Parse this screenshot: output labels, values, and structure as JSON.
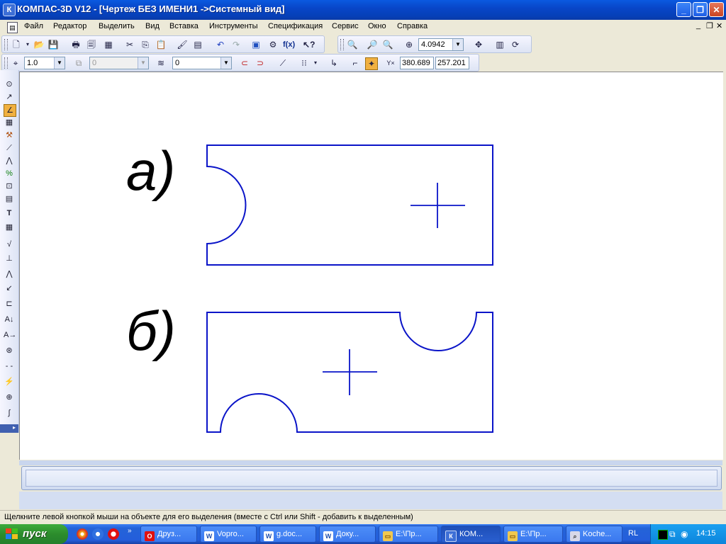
{
  "window": {
    "title": "КОМПАС-3D V12 - [Чертеж БЕЗ ИМЕНИ1 ->Системный вид]",
    "app_icon": "К"
  },
  "menu": {
    "items": [
      "Файл",
      "Редактор",
      "Выделить",
      "Вид",
      "Вставка",
      "Инструменты",
      "Спецификация",
      "Сервис",
      "Окно",
      "Справка"
    ]
  },
  "toolbar": {
    "zoom_value": "4.0942",
    "fx_label": "f(x)",
    "help_label": "?"
  },
  "params": {
    "scale_value": "1.0",
    "style_value": "0",
    "layer_value": "0",
    "x_coord": "380.689",
    "y_coord": "257.201"
  },
  "drawing": {
    "label_a": "а)",
    "label_b": "б)",
    "stroke_color": "#0a14c8"
  },
  "status": {
    "hint": "Щелкните левой кнопкой мыши на объекте для его выделения (вместе с Ctrl или Shift - добавить к выделенным)"
  },
  "taskbar": {
    "start_label": "пуск",
    "tasks": [
      "Друз...",
      "Vopro...",
      "g.doc...",
      "Доку...",
      "E:\\Пр...",
      "КОМ...",
      "E:\\Пр...",
      "Koche..."
    ],
    "lang": "RL",
    "clock": "14:15"
  }
}
